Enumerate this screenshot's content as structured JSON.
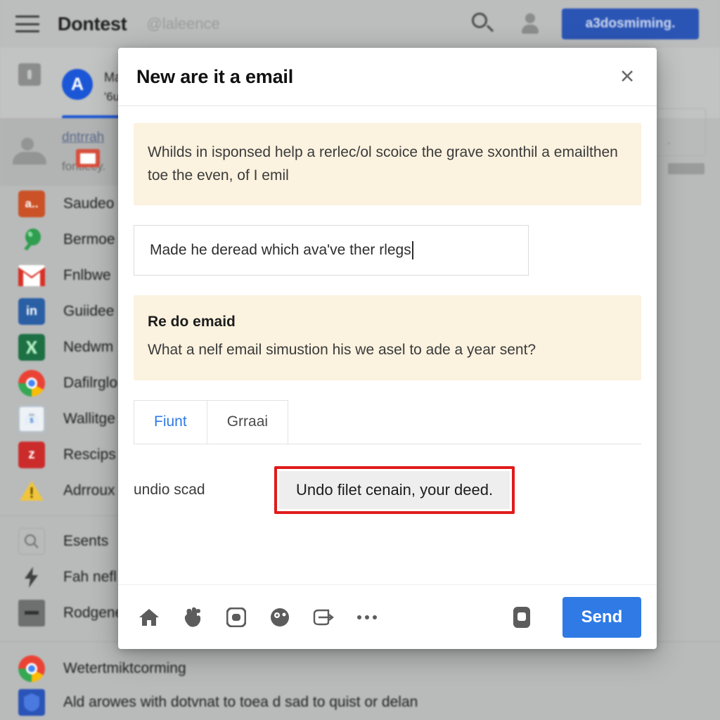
{
  "topbar": {
    "menu_icon": "hamburger-menu-icon",
    "title": "Dontest",
    "handle": "@laleence",
    "search_icon": "search-icon",
    "account_icon": "person-icon",
    "cta_label": "a3dosmiming."
  },
  "subheader": {
    "lock_icon": "lock-icon",
    "avatar_letter": "A",
    "line1": "Ma",
    "line2": "'6u",
    "more_dots": "· · ·"
  },
  "sidebar": {
    "featured": {
      "icon": "contact-card-icon",
      "title": "dntrrah",
      "subtitle": "fontlecy.",
      "badge_icon": "mail-badge-icon"
    },
    "items": [
      {
        "icon": "amazon-icon",
        "label": "Saudeo",
        "color": "#cb5226",
        "glyph": "a.."
      },
      {
        "icon": "balloon-icon",
        "label": "Bermoe",
        "color": "#2f9e4f",
        "glyph": ""
      },
      {
        "icon": "gmail-icon",
        "label": "Fnlbwe",
        "color": "#ffffff",
        "glyph": ""
      },
      {
        "icon": "linkedin-icon",
        "label": "Guiidee",
        "color": "#2a5fa5",
        "glyph": "in"
      },
      {
        "icon": "excel-icon",
        "label": "Nedwm",
        "color": "#1d7044",
        "glyph": ""
      },
      {
        "icon": "chrome-icon",
        "label": "Dafilrglo",
        "color": "#f5f5f5",
        "glyph": ""
      },
      {
        "icon": "briefcase-icon",
        "label": "Wallitge",
        "color": "#eef2f6",
        "glyph": ""
      },
      {
        "icon": "zoho-icon",
        "label": "Rescips",
        "color": "#cc2b2b",
        "glyph": "z"
      },
      {
        "icon": "warning-icon",
        "label": "Adrroux",
        "color": "#f0c020",
        "glyph": "!"
      }
    ],
    "secondary_items": [
      {
        "icon": "search-box-icon",
        "label": "Esents"
      },
      {
        "icon": "bolt-icon",
        "label": "Fah nefl"
      },
      {
        "icon": "minus-box-icon",
        "label": "Rodgene"
      }
    ],
    "bottom_items": [
      {
        "icon": "chrome-icon",
        "label": "Wetertmiktcorming"
      },
      {
        "icon": "shield-icon",
        "label": "Ald arowes with dotvnat to toea d sad to quist or delan"
      }
    ]
  },
  "modal": {
    "title": "New are it a email",
    "close_icon": "close-icon",
    "notice_top": "Whilds in isponsed help a rerlec/ol scoice the grave sxonthil a emailthen toe the even, of I emil",
    "input_value": "Made he deread which ava've ther rlegs",
    "input_placeholder": "Made he deread which ava've ther rlegs",
    "notice_mid_title": "Re do emaid",
    "notice_mid_body": "What a nelf email simustion his we asel to ade a year sent?",
    "tabs": [
      {
        "label": "Fiunt",
        "active": true
      },
      {
        "label": "Grraai",
        "active": false
      }
    ],
    "undo_label": "undio scad",
    "undo_button": "Undo filet cenain, your deed.",
    "footer_icons": [
      "home-icon",
      "hand-icon",
      "image-icon",
      "emoji-icon",
      "signature-icon",
      "more-options-icon"
    ],
    "footer_right_icon": "delete-icon",
    "send_label": "Send",
    "accent_color": "#2f7ae5",
    "highlight_color": "#e01b1b",
    "notice_bg": "#fbf2df"
  }
}
